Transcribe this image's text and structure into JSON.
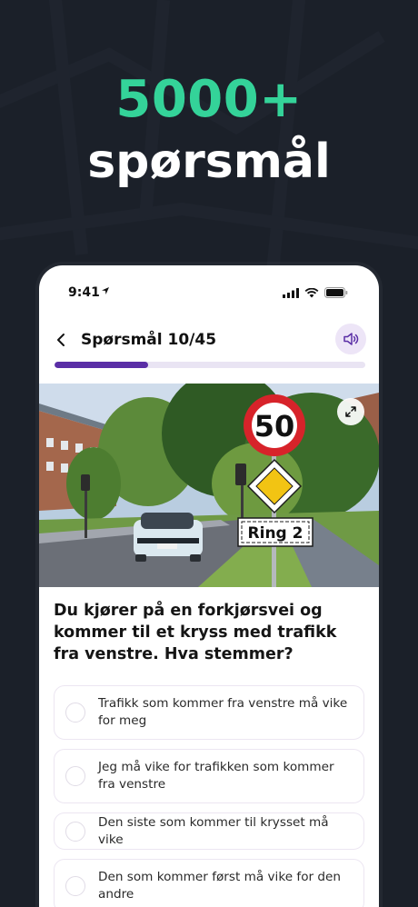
{
  "promo": {
    "headline": "5000+",
    "subheadline": "spørsmål"
  },
  "status_bar": {
    "time": "9:41"
  },
  "header": {
    "title": "Spørsmål 10/45",
    "progress": 0.3
  },
  "photo": {
    "speed_sign_text": "50",
    "street_sign_text": "Ring 2"
  },
  "question": {
    "text": "Du kjører på en forkjørsvei og kommer til et kryss med trafikk fra venstre. Hva stemmer?"
  },
  "options": [
    {
      "label": "Trafikk som kommer fra venstre må vike for meg"
    },
    {
      "label": "Jeg må vike for trafikken som kommer fra venstre"
    },
    {
      "label": "Den siste som kommer til krysset må vike"
    },
    {
      "label": "Den som kommer først må vike for den andre"
    }
  ],
  "colors": {
    "background": "#1b2029",
    "accent_green": "#34d399",
    "accent_purple": "#5a2ea6"
  }
}
